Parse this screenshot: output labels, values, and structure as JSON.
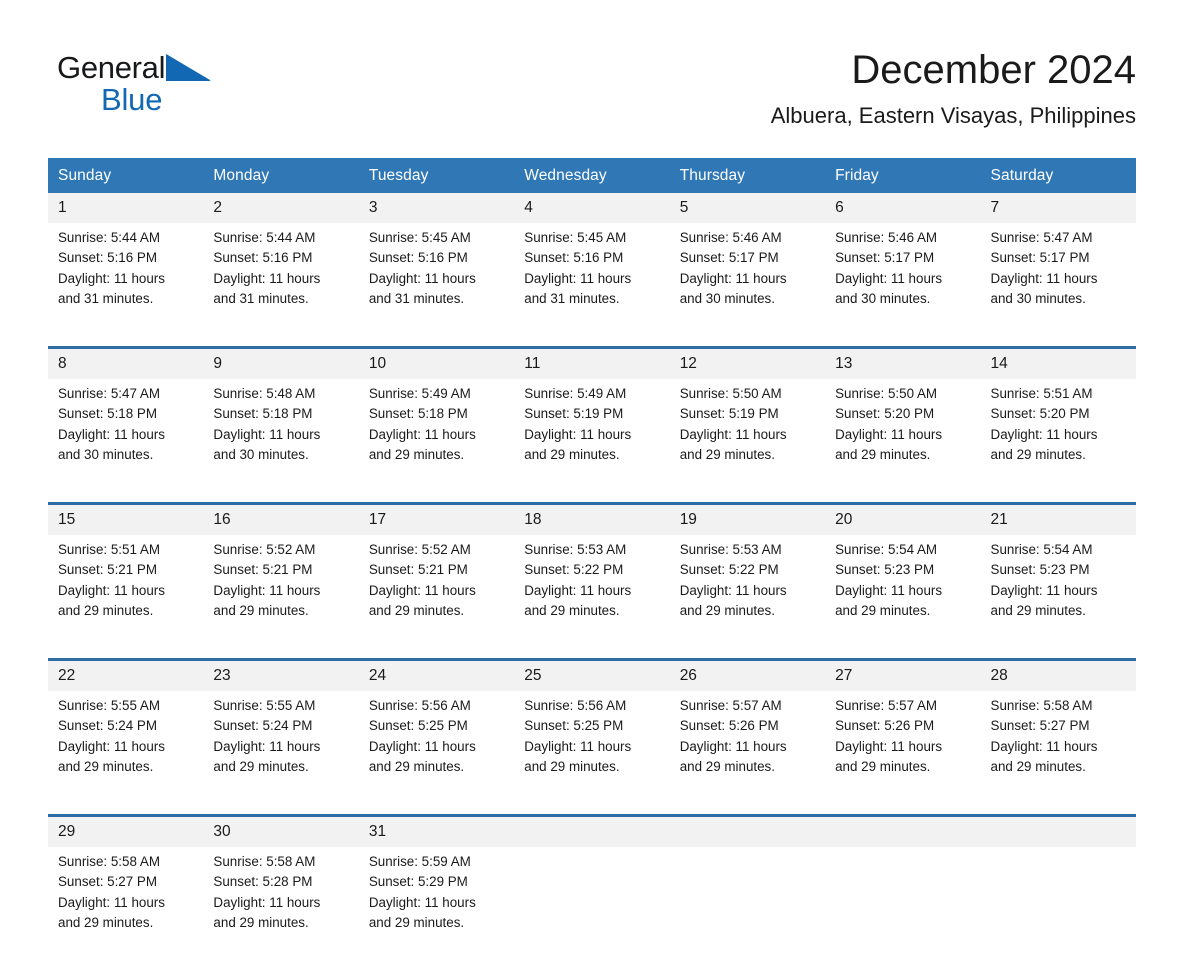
{
  "brand": {
    "logo_text_1": "General",
    "logo_text_2": "Blue",
    "logo_icon": "blue-triangle-icon",
    "accent_color": "#1268b3"
  },
  "header": {
    "title": "December 2024",
    "subtitle": "Albuera, Eastern Visayas, Philippines"
  },
  "theme": {
    "header_blue": "#3077B6",
    "separator_blue": "#2E6DA4",
    "daynum_background": "#f2f2f2"
  },
  "weekday_headers": [
    "Sunday",
    "Monday",
    "Tuesday",
    "Wednesday",
    "Thursday",
    "Friday",
    "Saturday"
  ],
  "weeks": [
    [
      {
        "day": "1",
        "sunrise": "Sunrise: 5:44 AM",
        "sunset": "Sunset: 5:16 PM",
        "daylight1": "Daylight: 11 hours",
        "daylight2": "and 31 minutes."
      },
      {
        "day": "2",
        "sunrise": "Sunrise: 5:44 AM",
        "sunset": "Sunset: 5:16 PM",
        "daylight1": "Daylight: 11 hours",
        "daylight2": "and 31 minutes."
      },
      {
        "day": "3",
        "sunrise": "Sunrise: 5:45 AM",
        "sunset": "Sunset: 5:16 PM",
        "daylight1": "Daylight: 11 hours",
        "daylight2": "and 31 minutes."
      },
      {
        "day": "4",
        "sunrise": "Sunrise: 5:45 AM",
        "sunset": "Sunset: 5:16 PM",
        "daylight1": "Daylight: 11 hours",
        "daylight2": "and 31 minutes."
      },
      {
        "day": "5",
        "sunrise": "Sunrise: 5:46 AM",
        "sunset": "Sunset: 5:17 PM",
        "daylight1": "Daylight: 11 hours",
        "daylight2": "and 30 minutes."
      },
      {
        "day": "6",
        "sunrise": "Sunrise: 5:46 AM",
        "sunset": "Sunset: 5:17 PM",
        "daylight1": "Daylight: 11 hours",
        "daylight2": "and 30 minutes."
      },
      {
        "day": "7",
        "sunrise": "Sunrise: 5:47 AM",
        "sunset": "Sunset: 5:17 PM",
        "daylight1": "Daylight: 11 hours",
        "daylight2": "and 30 minutes."
      }
    ],
    [
      {
        "day": "8",
        "sunrise": "Sunrise: 5:47 AM",
        "sunset": "Sunset: 5:18 PM",
        "daylight1": "Daylight: 11 hours",
        "daylight2": "and 30 minutes."
      },
      {
        "day": "9",
        "sunrise": "Sunrise: 5:48 AM",
        "sunset": "Sunset: 5:18 PM",
        "daylight1": "Daylight: 11 hours",
        "daylight2": "and 30 minutes."
      },
      {
        "day": "10",
        "sunrise": "Sunrise: 5:49 AM",
        "sunset": "Sunset: 5:18 PM",
        "daylight1": "Daylight: 11 hours",
        "daylight2": "and 29 minutes."
      },
      {
        "day": "11",
        "sunrise": "Sunrise: 5:49 AM",
        "sunset": "Sunset: 5:19 PM",
        "daylight1": "Daylight: 11 hours",
        "daylight2": "and 29 minutes."
      },
      {
        "day": "12",
        "sunrise": "Sunrise: 5:50 AM",
        "sunset": "Sunset: 5:19 PM",
        "daylight1": "Daylight: 11 hours",
        "daylight2": "and 29 minutes."
      },
      {
        "day": "13",
        "sunrise": "Sunrise: 5:50 AM",
        "sunset": "Sunset: 5:20 PM",
        "daylight1": "Daylight: 11 hours",
        "daylight2": "and 29 minutes."
      },
      {
        "day": "14",
        "sunrise": "Sunrise: 5:51 AM",
        "sunset": "Sunset: 5:20 PM",
        "daylight1": "Daylight: 11 hours",
        "daylight2": "and 29 minutes."
      }
    ],
    [
      {
        "day": "15",
        "sunrise": "Sunrise: 5:51 AM",
        "sunset": "Sunset: 5:21 PM",
        "daylight1": "Daylight: 11 hours",
        "daylight2": "and 29 minutes."
      },
      {
        "day": "16",
        "sunrise": "Sunrise: 5:52 AM",
        "sunset": "Sunset: 5:21 PM",
        "daylight1": "Daylight: 11 hours",
        "daylight2": "and 29 minutes."
      },
      {
        "day": "17",
        "sunrise": "Sunrise: 5:52 AM",
        "sunset": "Sunset: 5:21 PM",
        "daylight1": "Daylight: 11 hours",
        "daylight2": "and 29 minutes."
      },
      {
        "day": "18",
        "sunrise": "Sunrise: 5:53 AM",
        "sunset": "Sunset: 5:22 PM",
        "daylight1": "Daylight: 11 hours",
        "daylight2": "and 29 minutes."
      },
      {
        "day": "19",
        "sunrise": "Sunrise: 5:53 AM",
        "sunset": "Sunset: 5:22 PM",
        "daylight1": "Daylight: 11 hours",
        "daylight2": "and 29 minutes."
      },
      {
        "day": "20",
        "sunrise": "Sunrise: 5:54 AM",
        "sunset": "Sunset: 5:23 PM",
        "daylight1": "Daylight: 11 hours",
        "daylight2": "and 29 minutes."
      },
      {
        "day": "21",
        "sunrise": "Sunrise: 5:54 AM",
        "sunset": "Sunset: 5:23 PM",
        "daylight1": "Daylight: 11 hours",
        "daylight2": "and 29 minutes."
      }
    ],
    [
      {
        "day": "22",
        "sunrise": "Sunrise: 5:55 AM",
        "sunset": "Sunset: 5:24 PM",
        "daylight1": "Daylight: 11 hours",
        "daylight2": "and 29 minutes."
      },
      {
        "day": "23",
        "sunrise": "Sunrise: 5:55 AM",
        "sunset": "Sunset: 5:24 PM",
        "daylight1": "Daylight: 11 hours",
        "daylight2": "and 29 minutes."
      },
      {
        "day": "24",
        "sunrise": "Sunrise: 5:56 AM",
        "sunset": "Sunset: 5:25 PM",
        "daylight1": "Daylight: 11 hours",
        "daylight2": "and 29 minutes."
      },
      {
        "day": "25",
        "sunrise": "Sunrise: 5:56 AM",
        "sunset": "Sunset: 5:25 PM",
        "daylight1": "Daylight: 11 hours",
        "daylight2": "and 29 minutes."
      },
      {
        "day": "26",
        "sunrise": "Sunrise: 5:57 AM",
        "sunset": "Sunset: 5:26 PM",
        "daylight1": "Daylight: 11 hours",
        "daylight2": "and 29 minutes."
      },
      {
        "day": "27",
        "sunrise": "Sunrise: 5:57 AM",
        "sunset": "Sunset: 5:26 PM",
        "daylight1": "Daylight: 11 hours",
        "daylight2": "and 29 minutes."
      },
      {
        "day": "28",
        "sunrise": "Sunrise: 5:58 AM",
        "sunset": "Sunset: 5:27 PM",
        "daylight1": "Daylight: 11 hours",
        "daylight2": "and 29 minutes."
      }
    ],
    [
      {
        "day": "29",
        "sunrise": "Sunrise: 5:58 AM",
        "sunset": "Sunset: 5:27 PM",
        "daylight1": "Daylight: 11 hours",
        "daylight2": "and 29 minutes."
      },
      {
        "day": "30",
        "sunrise": "Sunrise: 5:58 AM",
        "sunset": "Sunset: 5:28 PM",
        "daylight1": "Daylight: 11 hours",
        "daylight2": "and 29 minutes."
      },
      {
        "day": "31",
        "sunrise": "Sunrise: 5:59 AM",
        "sunset": "Sunset: 5:29 PM",
        "daylight1": "Daylight: 11 hours",
        "daylight2": "and 29 minutes."
      },
      {
        "day": "",
        "sunrise": "",
        "sunset": "",
        "daylight1": "",
        "daylight2": ""
      },
      {
        "day": "",
        "sunrise": "",
        "sunset": "",
        "daylight1": "",
        "daylight2": ""
      },
      {
        "day": "",
        "sunrise": "",
        "sunset": "",
        "daylight1": "",
        "daylight2": ""
      },
      {
        "day": "",
        "sunrise": "",
        "sunset": "",
        "daylight1": "",
        "daylight2": ""
      }
    ]
  ]
}
